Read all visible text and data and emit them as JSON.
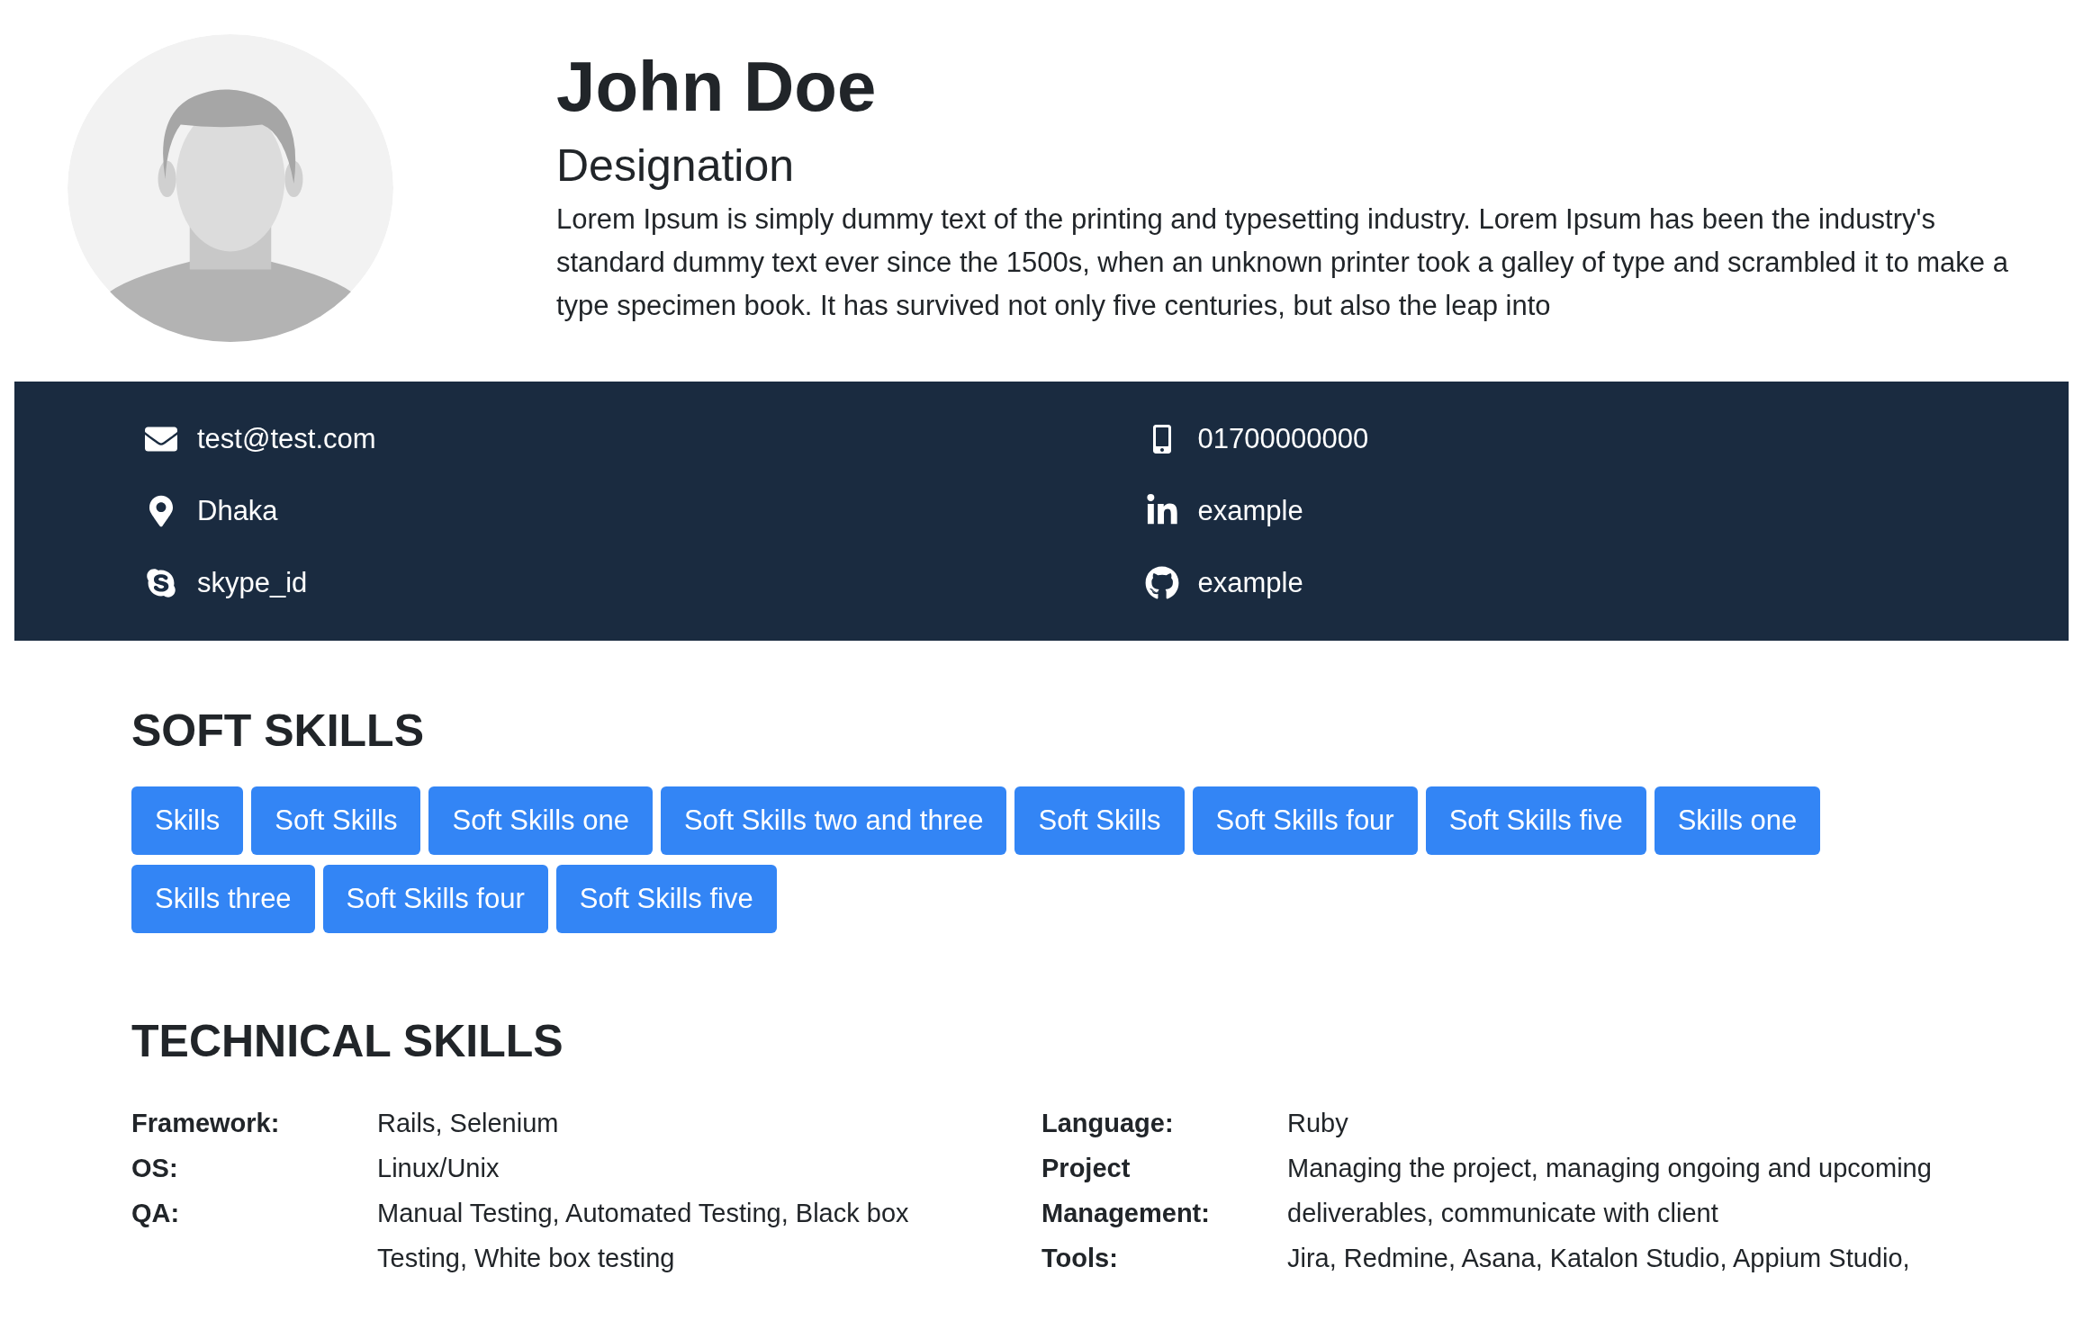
{
  "profile": {
    "name": "John Doe",
    "designation": "Designation",
    "bio": "Lorem Ipsum is simply dummy text of the printing and typesetting industry. Lorem Ipsum has been the industry's standard dummy text ever since the 1500s, when an unknown printer took a galley of type and scrambled it to make a type specimen book. It has survived not only five centuries, but also the leap into"
  },
  "contacts": [
    {
      "kind": "email",
      "text": "test@test.com"
    },
    {
      "kind": "phone",
      "text": "01700000000"
    },
    {
      "kind": "location",
      "text": "Dhaka"
    },
    {
      "kind": "linkedin",
      "text": "example"
    },
    {
      "kind": "skype",
      "text": "skype_id"
    },
    {
      "kind": "github",
      "text": "example"
    }
  ],
  "soft_skills": {
    "title": "SOFT SKILLS",
    "items": [
      "Skills",
      "Soft Skills",
      "Soft Skills one",
      "Soft Skills two and three",
      "Soft Skills",
      "Soft Skills four",
      "Soft Skills five",
      "Skills one",
      "Skills three",
      "Soft Skills four",
      "Soft Skills five"
    ]
  },
  "technical_skills": {
    "title": "TECHNICAL SKILLS",
    "columns": [
      [
        {
          "label": "Framework:",
          "value": "Rails, Selenium"
        },
        {
          "label": "OS:",
          "value": "Linux/Unix"
        },
        {
          "label": "QA:",
          "value": "Manual Testing, Automated Testing, Black box Testing, White box testing"
        }
      ],
      [
        {
          "label": "Language:",
          "value": "Ruby"
        },
        {
          "label": "Project Management:",
          "value": "Managing the project, managing ongoing and upcoming deliverables, communicate with client"
        },
        {
          "label": "Tools:",
          "value": "Jira, Redmine, Asana, Katalon Studio, Appium Studio,"
        }
      ]
    ]
  }
}
